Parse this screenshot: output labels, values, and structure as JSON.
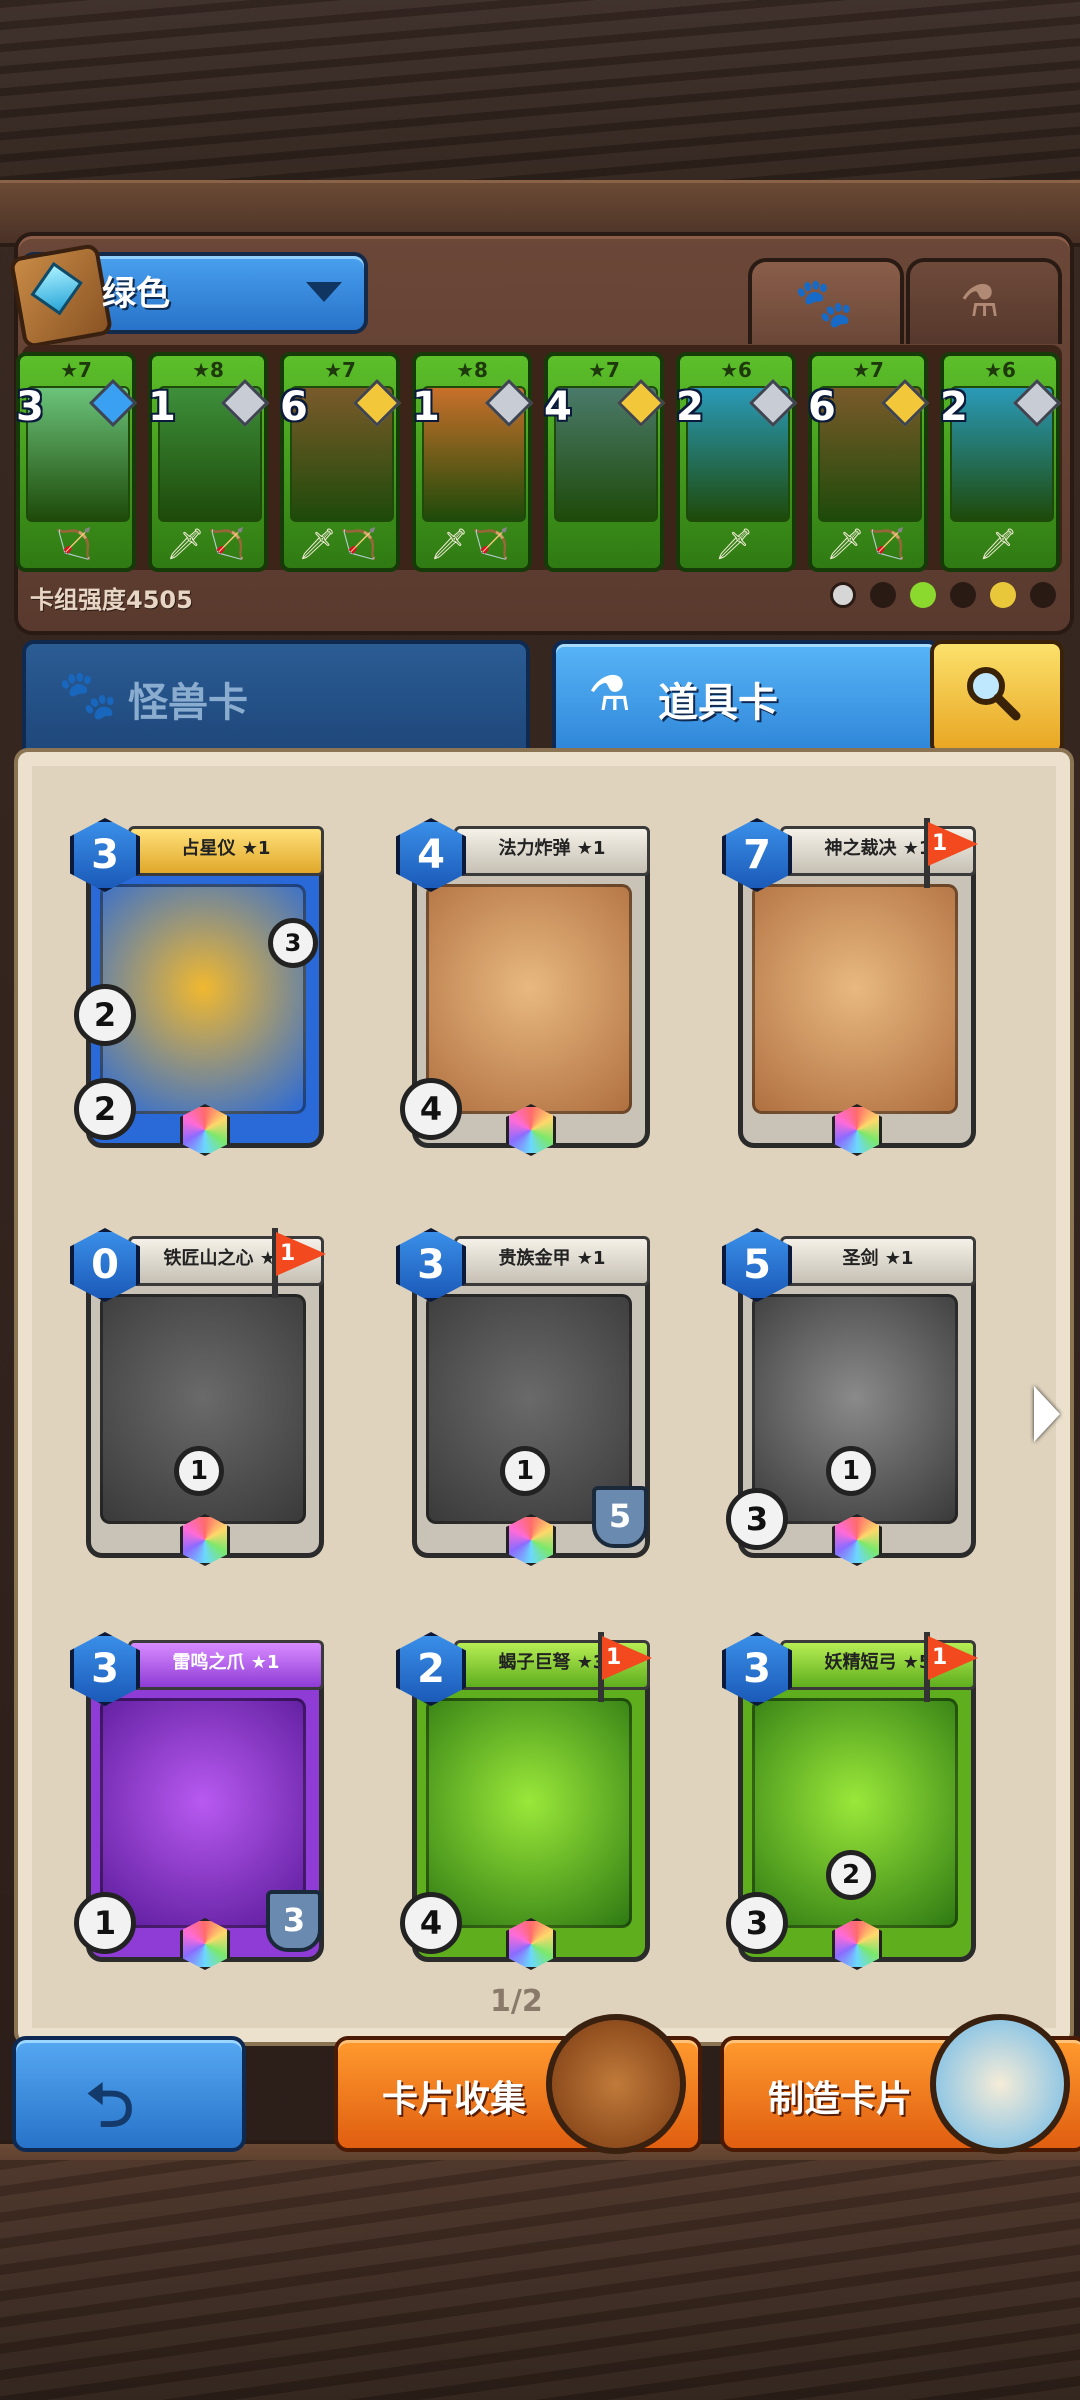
{
  "deck": {
    "name": "绿色",
    "power_label": "卡组强度4505",
    "cards": [
      {
        "stars": "★7",
        "cost": "3",
        "gem": "blue",
        "color": "#6bc37a",
        "weapons": "🏹"
      },
      {
        "stars": "★8",
        "cost": "1",
        "gem": "silver",
        "color": "#3d8f3a",
        "weapons": "🗡🏹"
      },
      {
        "stars": "★7",
        "cost": "6",
        "gem": "gold",
        "color": "#7a5a2a",
        "weapons": "🗡🏹"
      },
      {
        "stars": "★8",
        "cost": "1",
        "gem": "silver",
        "color": "#c8702a",
        "weapons": "🗡🏹"
      },
      {
        "stars": "★7",
        "cost": "4",
        "gem": "gold",
        "color": "#4a7a6a",
        "weapons": ""
      },
      {
        "stars": "★6",
        "cost": "2",
        "gem": "silver",
        "color": "#2a9ab8",
        "weapons": "🗡"
      },
      {
        "stars": "★7",
        "cost": "6",
        "gem": "gold",
        "color": "#7a5a2a",
        "weapons": "🗡🏹"
      },
      {
        "stars": "★6",
        "cost": "2",
        "gem": "silver",
        "color": "#2a9ab8",
        "weapons": "🗡"
      }
    ]
  },
  "tabs": {
    "monster": "怪兽卡",
    "item": "道具卡"
  },
  "cards": [
    {
      "name": "占星仪 ★1",
      "cost": "3",
      "banner": "gold",
      "art": [
        "#f0b830",
        "#2a6ad8"
      ],
      "stat_left_top": "2",
      "stat_left_bottom": "2",
      "side_value": "3",
      "flag": ""
    },
    {
      "name": "法力炸弹 ★1",
      "cost": "4",
      "banner": "silver",
      "art": [
        "#e8b880",
        "#b07040"
      ],
      "stat_left_bottom": "4",
      "flag": ""
    },
    {
      "name": "神之裁决 ★1",
      "cost": "7",
      "banner": "silver",
      "art": [
        "#e8b880",
        "#b07040"
      ],
      "flag": "1"
    },
    {
      "name": "铁匠山之心 ★1",
      "cost": "0",
      "banner": "silver",
      "art": [
        "#6a6a6a",
        "#3a3a3a"
      ],
      "center_value": "1",
      "flag": "1"
    },
    {
      "name": "贵族金甲 ★1",
      "cost": "3",
      "banner": "silver",
      "art": [
        "#6a6a6a",
        "#3a3a3a"
      ],
      "center_value": "1",
      "shield": "5",
      "flag": ""
    },
    {
      "name": "圣剑 ★1",
      "cost": "5",
      "banner": "silver",
      "art": [
        "#8a8a8a",
        "#3a3a3a"
      ],
      "center_value": "1",
      "stat_left_bottom": "3",
      "flag": ""
    },
    {
      "name": "雷鸣之爪 ★1",
      "cost": "3",
      "banner": "purple",
      "art": [
        "#b85af0",
        "#5a1a9a"
      ],
      "stat_left_bottom": "1",
      "shield": "3",
      "flag": ""
    },
    {
      "name": "蝎子巨弩 ★3",
      "cost": "2",
      "banner": "green",
      "art": [
        "#9ae83a",
        "#2f7a13"
      ],
      "stat_left_bottom": "4",
      "flag": "1"
    },
    {
      "name": "妖精短弓 ★5",
      "cost": "3",
      "banner": "green",
      "art": [
        "#9ae83a",
        "#2f7a13"
      ],
      "stat_left_bottom": "3",
      "center_value": "2",
      "flag": "1"
    }
  ],
  "pagination": "1/2",
  "buttons": {
    "card_collection": "卡片收集",
    "craft_card": "制造卡片"
  },
  "icons": {
    "deck_book": "deck-book-icon",
    "paw": "paw-icon",
    "flask": "flask-icon",
    "search": "search-icon",
    "back": "back-arrow-icon",
    "next": "next-page-arrow-icon"
  }
}
